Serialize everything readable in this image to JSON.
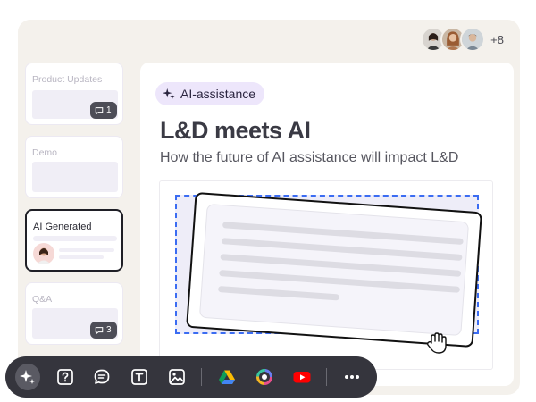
{
  "collaborators": {
    "more_label": "+8"
  },
  "slides": [
    {
      "title": "Product Updates",
      "comment_count": "1"
    },
    {
      "title": "Demo"
    },
    {
      "title": "AI Generated"
    },
    {
      "title": "Q&A",
      "comment_count": "3"
    }
  ],
  "canvas": {
    "pill_label": "AI-assistance",
    "heading": "L&D meets AI",
    "subtitle": "How the future of AI assistance will impact L&D"
  },
  "toolbar": {
    "icons": [
      "sparkle-icon",
      "question-icon",
      "chat-icon",
      "text-icon",
      "image-icon",
      "google-drive-icon",
      "color-ring-icon",
      "youtube-icon",
      "more-icon"
    ]
  },
  "colors": {
    "accent": "#3b6cf2",
    "pill_bg": "#ede6fb",
    "toolbar_bg": "#35353d",
    "youtube": "#ff0000"
  }
}
